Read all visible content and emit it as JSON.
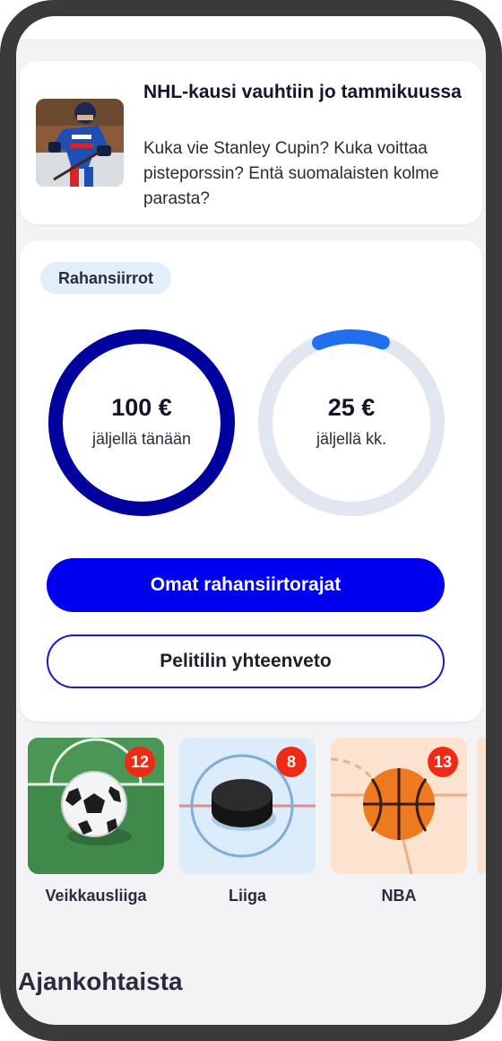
{
  "news": {
    "title": "NHL-kausi vauhtiin jo tammikuussa",
    "text": "Kuka vie Stanley Cupin? Kuka voittaa pisteporssin? Entä suomalaisten kolme parasta?"
  },
  "money": {
    "chip": "Rahansiirrot",
    "daily": {
      "amount": "100 €",
      "label": "jäljellä tänään",
      "fraction": 1.0,
      "color": "#00009e"
    },
    "monthly": {
      "amount": "25 €",
      "label": "jäljellä kk.",
      "fraction": 0.12,
      "color": "#1f6ff0",
      "track": "#e1e7f0"
    },
    "primary_button": "Omat rahansiirtorajat",
    "secondary_button": "Pelitilin yhteenveto"
  },
  "sports": [
    {
      "label": "Veikkausliiga",
      "count": "12",
      "icon": "soccer-ball-icon"
    },
    {
      "label": "Liiga",
      "count": "8",
      "icon": "hockey-puck-icon"
    },
    {
      "label": "NBA",
      "count": "13",
      "icon": "basketball-icon"
    }
  ],
  "section": {
    "title": "Ajankohtaista"
  }
}
